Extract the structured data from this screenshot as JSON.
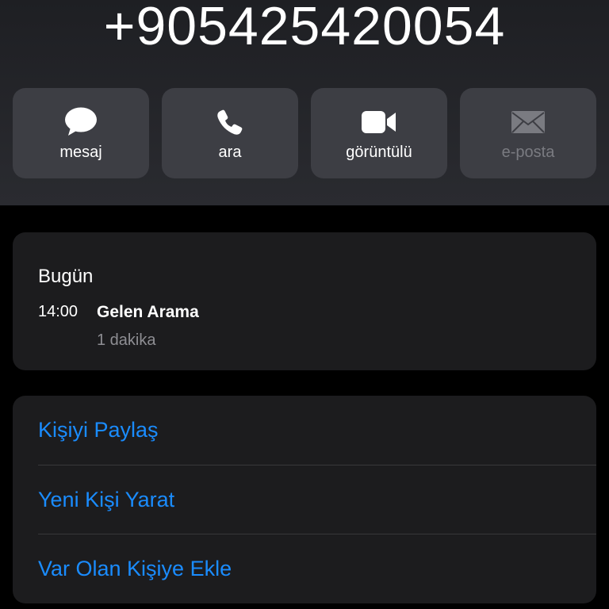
{
  "contact": {
    "phone_number": "+905425420054"
  },
  "actions": [
    {
      "label": "mesaj",
      "icon": "message-bubble-icon",
      "enabled": true
    },
    {
      "label": "ara",
      "icon": "phone-icon",
      "enabled": true
    },
    {
      "label": "görüntülü",
      "icon": "video-camera-icon",
      "enabled": true
    },
    {
      "label": "e-posta",
      "icon": "envelope-icon",
      "enabled": false
    }
  ],
  "history": {
    "day": "Bugün",
    "entries": [
      {
        "time": "14:00",
        "type": "Gelen Arama",
        "duration": "1 dakika"
      }
    ]
  },
  "options": [
    {
      "label": "Kişiyi Paylaş"
    },
    {
      "label": "Yeni Kişi Yarat"
    },
    {
      "label": "Var Olan Kişiye Ekle"
    }
  ],
  "colors": {
    "accent": "#1a8cff",
    "card_background": "#1c1c1e",
    "button_background": "#3d3e44",
    "disabled_text": "#7a7b81"
  }
}
